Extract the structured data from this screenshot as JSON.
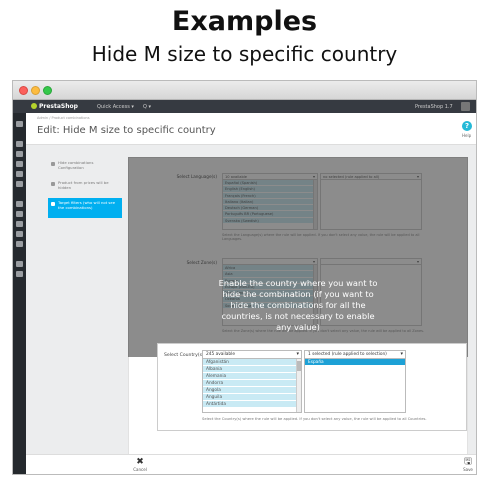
{
  "hero": {
    "title": "Examples",
    "subtitle": "Hide M size to specific country"
  },
  "topbar": {
    "logo": "PrestaShop",
    "quick_access": "Quick Access ▾",
    "search": "Q ▾",
    "version": "PrestaShop 1.7"
  },
  "header": {
    "breadcrumb": "Admin / Product combinations",
    "title": "Edit: Hide M size to specific country",
    "help_label": "Help"
  },
  "tabs": [
    {
      "label": "Hide combinations Configuration"
    },
    {
      "label": "Product from prices will be hidden"
    },
    {
      "label": "Target filters (who will not see the combinations)"
    }
  ],
  "languages": {
    "label": "Select Language(s)",
    "available": "10 available",
    "selected": "no selected (rule applied to all)",
    "options": [
      "Español (Spanish)",
      "English (English)",
      "Français (French)",
      "Italiano (Italian)",
      "Deutsch (German)",
      "Português BR (Portuguese)",
      "Svenska (Swedish)"
    ],
    "help": "Select the Language(s) where the rule will be applied. If you don't select any value, the rule will be applied to all Languages."
  },
  "zones": {
    "label": "Select Zone(s)",
    "options": [
      "Africa",
      "Asia",
      "Europe",
      "Europe (non-EU)",
      "North America",
      "Oceania",
      "South America"
    ],
    "help": "Select the Zone(s) where the rule will be applied. If you don't select any value, the rule will be applied to all Zones."
  },
  "overlay": {
    "text": "Enable the country where you want to hide the combination (if you want to hide the combinations for all the countries, is not necessary to enable any value)"
  },
  "countries": {
    "label": "Select Country(s)",
    "available": "245 available",
    "selected": "1 selected (rule applied to selection)",
    "options": [
      "Afganistán",
      "Albania",
      "Alemania",
      "Andorra",
      "Angola",
      "Anguila",
      "Antártida"
    ],
    "selected_options": [
      "España"
    ],
    "help": "Select the Country(s) where the rule will be applied. If you don't select any value, the rule will be applied to all Countries."
  },
  "footer": {
    "cancel": "Cancel",
    "save": "Save"
  }
}
